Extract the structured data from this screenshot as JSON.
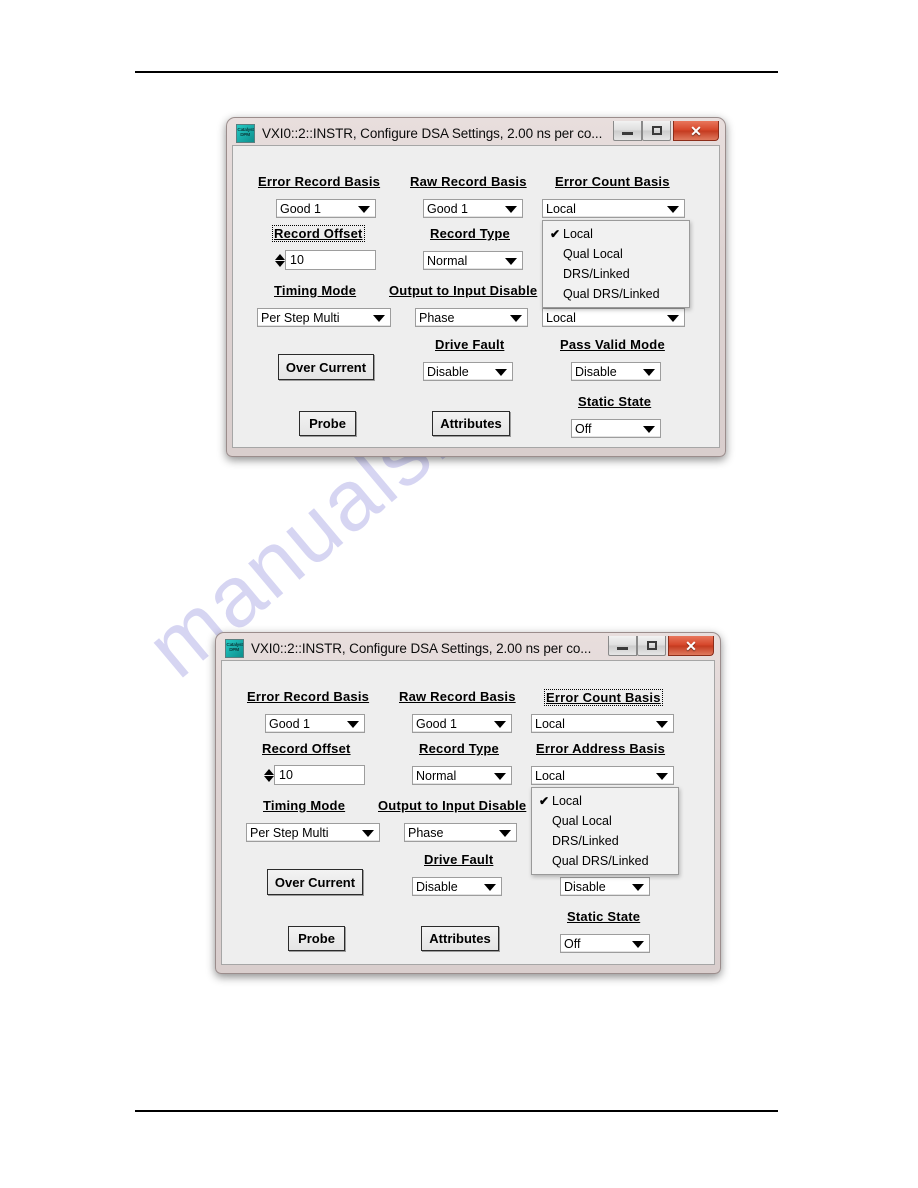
{
  "document": {
    "watermark_text": "manualshive.com"
  },
  "windows": [
    {
      "id": "dialog-1",
      "title": "VXI0::2::INSTR, Configure DSA Settings, 2.00 ns per co...",
      "icon": "dpm-app-icon",
      "icon_text_top": "Catalyst",
      "icon_text_bottom": "DPM",
      "buttons": {
        "minimize": "Minimize",
        "maximize": "Restore",
        "close": "✕"
      },
      "labels": {
        "error_record_basis": "Error Record Basis",
        "raw_record_basis": "Raw Record Basis",
        "error_count_basis": "Error Count Basis",
        "record_offset": "Record Offset",
        "record_type": "Record Type",
        "timing_mode": "Timing Mode",
        "output_to_input_disable": "Output to Input Disable",
        "drive_fault": "Drive Fault",
        "pass_valid_mode": "Pass Valid Mode",
        "static_state": "Static State"
      },
      "values": {
        "error_record_basis": "Good 1",
        "raw_record_basis": "Good 1",
        "error_count_basis": "Local",
        "record_offset": "10",
        "record_type": "Normal",
        "timing_mode": "Per Step Multi",
        "output_to_input_disable": "Phase",
        "error_address_basis": "Local",
        "drive_fault": "Disable",
        "pass_valid_mode": "Disable",
        "static_state": "Off"
      },
      "buttons_main": {
        "over_current": "Over Current",
        "probe": "Probe",
        "attributes": "Attributes"
      },
      "open_dropdown": {
        "owner": "error_count_basis",
        "selected": "Local",
        "check_glyph": "✔",
        "items": [
          "Local",
          "Qual Local",
          "DRS/Linked",
          "Qual DRS/Linked"
        ]
      }
    },
    {
      "id": "dialog-2",
      "title": "VXI0::2::INSTR, Configure DSA Settings, 2.00 ns per co...",
      "icon": "dpm-app-icon",
      "icon_text_top": "Catalyst",
      "icon_text_bottom": "DPM",
      "buttons": {
        "minimize": "Minimize",
        "maximize": "Restore",
        "close": "✕"
      },
      "labels": {
        "error_record_basis": "Error Record Basis",
        "raw_record_basis": "Raw Record Basis",
        "error_count_basis": "Error Count Basis",
        "record_offset": "Record Offset",
        "record_type": "Record Type",
        "error_address_basis": "Error Address Basis",
        "timing_mode": "Timing Mode",
        "output_to_input_disable": "Output to Input Disable",
        "drive_fault": "Drive Fault",
        "static_state": "Static State"
      },
      "values": {
        "error_record_basis": "Good 1",
        "raw_record_basis": "Good 1",
        "error_count_basis": "Local",
        "record_offset": "10",
        "record_type": "Normal",
        "error_address_basis": "Local",
        "timing_mode": "Per Step Multi",
        "output_to_input_disable": "Phase",
        "drive_fault": "Disable",
        "pass_valid_mode": "Disable",
        "static_state": "Off"
      },
      "buttons_main": {
        "over_current": "Over Current",
        "probe": "Probe",
        "attributes": "Attributes"
      },
      "open_dropdown": {
        "owner": "error_address_basis",
        "selected": "Local",
        "check_glyph": "✔",
        "items": [
          "Local",
          "Qual Local",
          "DRS/Linked",
          "Qual DRS/Linked"
        ]
      }
    }
  ]
}
